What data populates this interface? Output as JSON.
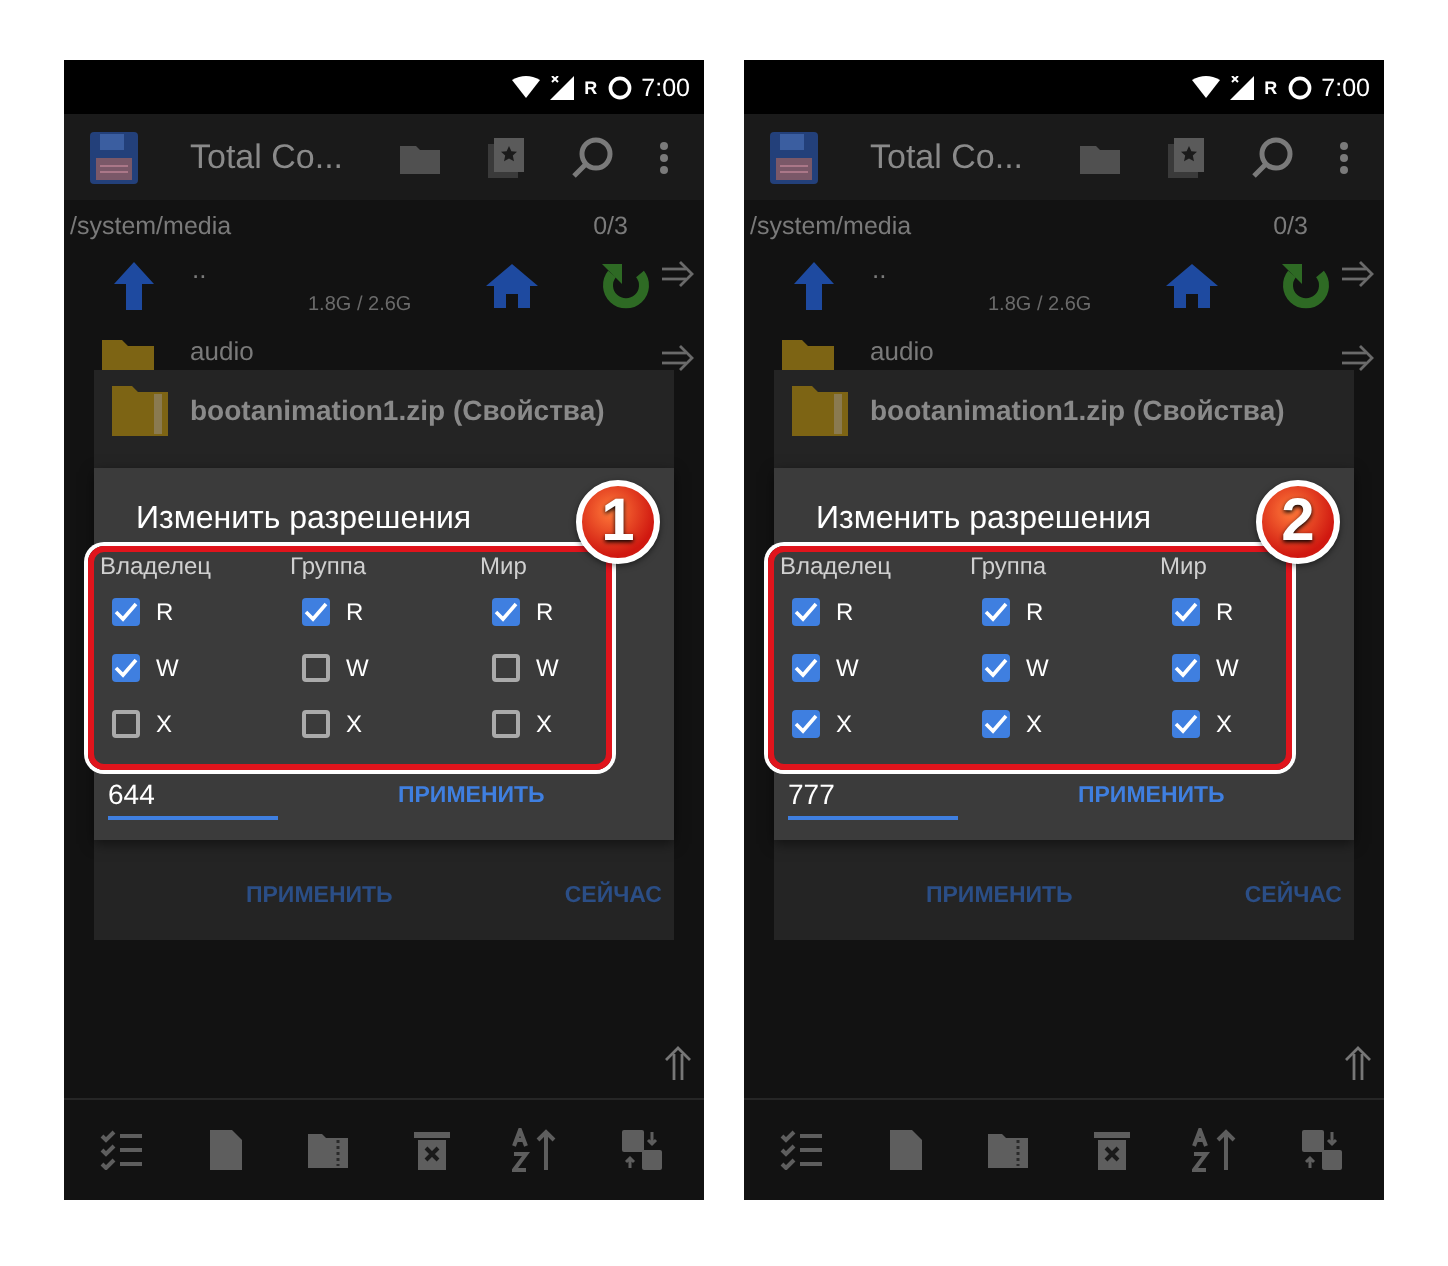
{
  "screens": [
    {
      "status_bar": {
        "network_label": "R",
        "time": "7:00"
      },
      "app_bar": {
        "title": "Total Co..."
      },
      "path": {
        "location": "/system/media",
        "count": "0/3"
      },
      "files": [
        {
          "kind": "parent",
          "name": "..",
          "size": "1.8G / 2.6G"
        },
        {
          "kind": "folder",
          "name": "audio"
        }
      ],
      "properties_dialog": {
        "title": "bootanimation1.zip (Свойства)",
        "buttons": [
          "ПРИМЕНИТЬ",
          "СЕЙЧАС"
        ]
      },
      "permissions_dialog": {
        "title": "Изменить разрешения",
        "columns": [
          {
            "label": "Владелец",
            "permissions": [
              {
                "label": "R",
                "checked": true
              },
              {
                "label": "W",
                "checked": true
              },
              {
                "label": "X",
                "checked": false
              }
            ]
          },
          {
            "label": "Группа",
            "permissions": [
              {
                "label": "R",
                "checked": true
              },
              {
                "label": "W",
                "checked": false
              },
              {
                "label": "X",
                "checked": false
              }
            ]
          },
          {
            "label": "Мир",
            "permissions": [
              {
                "label": "R",
                "checked": true
              },
              {
                "label": "W",
                "checked": false
              },
              {
                "label": "X",
                "checked": false
              }
            ]
          }
        ],
        "mode": "644",
        "apply_button": "ПРИМЕНИТЬ"
      },
      "step_badge": "1"
    },
    {
      "status_bar": {
        "network_label": "R",
        "time": "7:00"
      },
      "app_bar": {
        "title": "Total Co..."
      },
      "path": {
        "location": "/system/media",
        "count": "0/3"
      },
      "files": [
        {
          "kind": "parent",
          "name": "..",
          "size": "1.8G / 2.6G"
        },
        {
          "kind": "folder",
          "name": "audio"
        }
      ],
      "properties_dialog": {
        "title": "bootanimation1.zip (Свойства)",
        "buttons": [
          "ПРИМЕНИТЬ",
          "СЕЙЧАС"
        ]
      },
      "permissions_dialog": {
        "title": "Изменить разрешения",
        "columns": [
          {
            "label": "Владелец",
            "permissions": [
              {
                "label": "R",
                "checked": true
              },
              {
                "label": "W",
                "checked": true
              },
              {
                "label": "X",
                "checked": true
              }
            ]
          },
          {
            "label": "Группа",
            "permissions": [
              {
                "label": "R",
                "checked": true
              },
              {
                "label": "W",
                "checked": true
              },
              {
                "label": "X",
                "checked": true
              }
            ]
          },
          {
            "label": "Мир",
            "permissions": [
              {
                "label": "R",
                "checked": true
              },
              {
                "label": "W",
                "checked": true
              },
              {
                "label": "X",
                "checked": true
              }
            ]
          }
        ],
        "mode": "777",
        "apply_button": "ПРИМЕНИТЬ"
      },
      "step_badge": "2"
    }
  ]
}
